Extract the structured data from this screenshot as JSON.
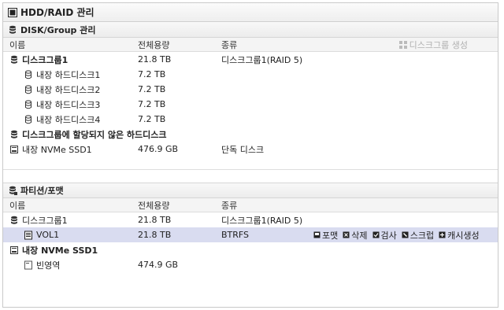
{
  "title": "HDD/RAID 관리",
  "disk_section": {
    "heading": "DISK/Group 관리",
    "columns": [
      "이름",
      "전체용량",
      "종류"
    ],
    "create_group_label": "디스크그룹 생성",
    "rows": [
      {
        "name": "디스크그룹1",
        "capacity": "21.8 TB",
        "type": "디스크그룹1(RAID 5)"
      },
      {
        "name": "내장 하드디스크1",
        "capacity": "7.2 TB",
        "type": ""
      },
      {
        "name": "내장 하드디스크2",
        "capacity": "7.2 TB",
        "type": ""
      },
      {
        "name": "내장 하드디스크3",
        "capacity": "7.2 TB",
        "type": ""
      },
      {
        "name": "내장 하드디스크4",
        "capacity": "7.2 TB",
        "type": ""
      },
      {
        "name": "디스크그룹에 할당되지 않은 하드디스크",
        "capacity": "",
        "type": ""
      },
      {
        "name": "내장 NVMe SSD1",
        "capacity": "476.9 GB",
        "type": "단독 디스크"
      }
    ]
  },
  "partition_section": {
    "heading": "파티션/포맷",
    "columns": [
      "이름",
      "전체용량",
      "종류"
    ],
    "rows": [
      {
        "name": "디스크그룹1",
        "capacity": "21.8 TB",
        "type": "디스크그룹1(RAID 5)"
      },
      {
        "name": "VOL1",
        "capacity": "21.8 TB",
        "type": "BTRFS"
      },
      {
        "name": "내장 NVMe SSD1",
        "capacity": "",
        "type": ""
      },
      {
        "name": "빈영역",
        "capacity": "474.9 GB",
        "type": ""
      }
    ],
    "actions": [
      "포맷",
      "삭제",
      "검사",
      "스크럽",
      "캐시생성"
    ]
  },
  "colors": {
    "selected_row": "#d9dcf0",
    "disabled_text": "#b0b0b0"
  }
}
